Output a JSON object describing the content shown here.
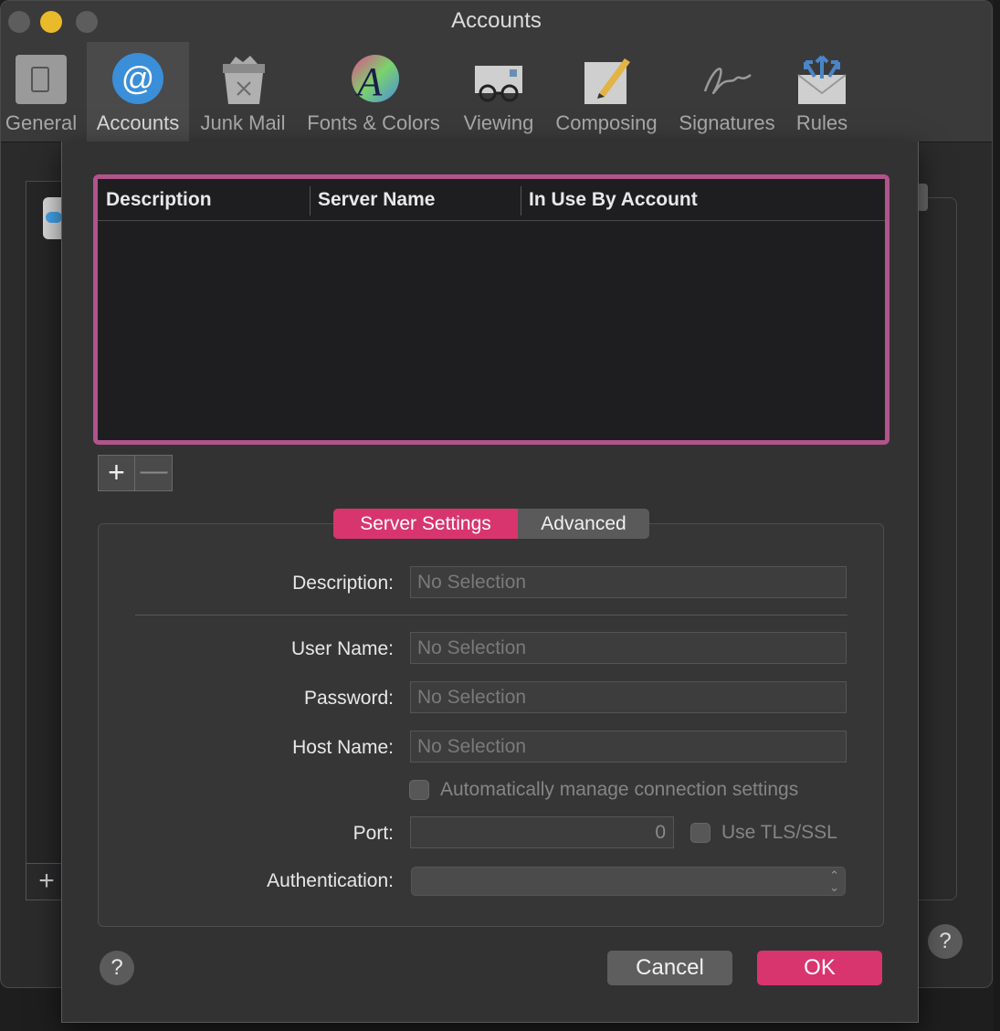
{
  "window": {
    "title": "Accounts"
  },
  "toolbar": {
    "items": [
      {
        "label": "General",
        "icon": "general-icon"
      },
      {
        "label": "Accounts",
        "icon": "at-sign-icon"
      },
      {
        "label": "Junk Mail",
        "icon": "trash-icon"
      },
      {
        "label": "Fonts & Colors",
        "icon": "font-colors-icon"
      },
      {
        "label": "Viewing",
        "icon": "glasses-icon"
      },
      {
        "label": "Composing",
        "icon": "pencil-icon"
      },
      {
        "label": "Signatures",
        "icon": "signature-icon"
      },
      {
        "label": "Rules",
        "icon": "envelope-arrows-icon"
      }
    ],
    "active": "Accounts"
  },
  "server_table": {
    "columns": [
      "Description",
      "Server Name",
      "In Use By Account"
    ],
    "rows": []
  },
  "list_controls": {
    "add": "+",
    "remove": "—"
  },
  "tabs": {
    "server_settings": "Server Settings",
    "advanced": "Advanced"
  },
  "form": {
    "description_label": "Description:",
    "description_placeholder": "No Selection",
    "username_label": "User Name:",
    "username_placeholder": "No Selection",
    "password_label": "Password:",
    "password_placeholder": "No Selection",
    "hostname_label": "Host Name:",
    "hostname_placeholder": "No Selection",
    "auto_manage_label": "Automatically manage connection settings",
    "port_label": "Port:",
    "port_value": "0",
    "tls_label": "Use TLS/SSL",
    "auth_label": "Authentication:",
    "auth_value": ""
  },
  "buttons": {
    "help": "?",
    "cancel": "Cancel",
    "ok": "OK"
  },
  "colors": {
    "accent": "#d8356f",
    "table_focus_ring": "#b0548c",
    "accounts_icon": "#3a8fd8"
  }
}
